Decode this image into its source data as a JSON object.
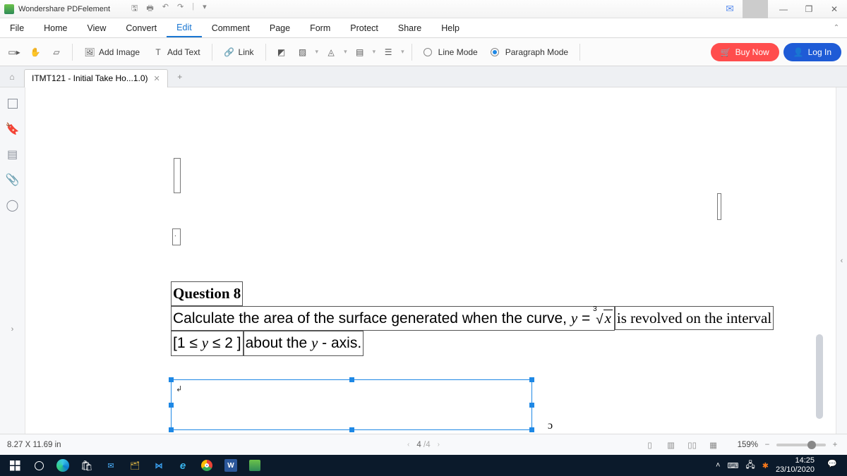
{
  "app": {
    "name": "Wondershare PDFelement"
  },
  "menu": {
    "items": [
      "File",
      "Home",
      "View",
      "Convert",
      "Edit",
      "Comment",
      "Page",
      "Form",
      "Protect",
      "Share",
      "Help"
    ],
    "active": 4
  },
  "ribbon": {
    "add_image": "Add Image",
    "add_text": "Add Text",
    "link": "Link",
    "line_mode": "Line Mode",
    "paragraph_mode": "Paragraph Mode",
    "buy_now": "Buy Now",
    "log_in": "Log In"
  },
  "tab": {
    "title": "ITMT121 - Initial Take Ho...1.0)"
  },
  "doc": {
    "q_title": "Question 8",
    "line1a": "Calculate the area of the surface generated when the curve, ",
    "line1b_y": "y",
    "line1b_eq": " = ",
    "line1b_root_index": "3",
    "line1b_root_arg": "x",
    "line1c": " is revolved on the interval",
    "line2a": "[1 ≤ ",
    "line2a_y": "y",
    "line2a_end": " ≤  2 ]",
    "line2b": " about the ",
    "line2b_y": "y",
    "line2b_end": " - axis.",
    "stray": "ɔ"
  },
  "status": {
    "dims": "8.27 X 11.69 in",
    "page_current": "4",
    "page_sep": " /4",
    "zoom": "159%"
  },
  "clock": {
    "time": "14:25",
    "date": "23/10/2020"
  }
}
